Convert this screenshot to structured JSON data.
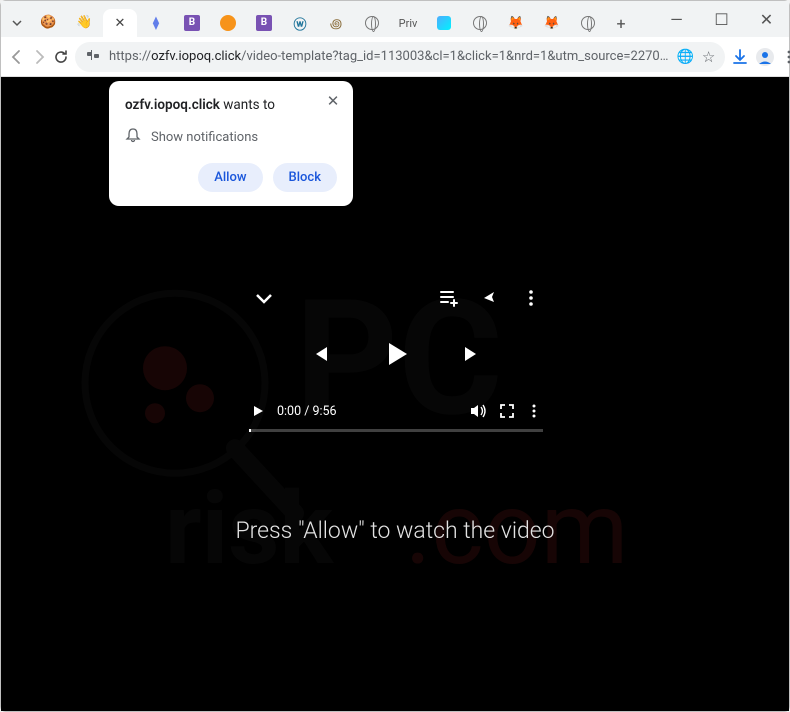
{
  "window": {
    "tabs": [
      {
        "icon": "chevron-down",
        "label": ""
      },
      {
        "icon": "curl",
        "label": ""
      },
      {
        "icon": "wave",
        "label": ""
      },
      {
        "icon": "x",
        "label": "",
        "active": true
      },
      {
        "icon": "eth",
        "label": ""
      },
      {
        "icon": "b",
        "label": "B"
      },
      {
        "icon": "btc",
        "label": ""
      },
      {
        "icon": "b",
        "label": "B"
      },
      {
        "icon": "wp",
        "label": ""
      },
      {
        "icon": "spiral",
        "label": ""
      },
      {
        "icon": "globe",
        "label": ""
      },
      {
        "icon": "priv",
        "label": "Priv"
      },
      {
        "icon": "blue",
        "label": ""
      },
      {
        "icon": "globe",
        "label": ""
      },
      {
        "icon": "fox",
        "label": ""
      },
      {
        "icon": "fox",
        "label": ""
      },
      {
        "icon": "globe",
        "label": ""
      }
    ],
    "newtab": "+",
    "controls": {
      "minimize": "—",
      "maximize": "☐",
      "close": "✕"
    }
  },
  "addressbar": {
    "scheme": "https://",
    "host": "ozfv.iopoq.click",
    "path": "/video-template?tag_id=113003&cl=1&click=1&nrd=1&utm_source=2270…"
  },
  "permission": {
    "domain": "ozfv.iopoq.click",
    "wants_to": " wants to",
    "show_notifications": "Show notifications",
    "allow": "Allow",
    "block": "Block"
  },
  "player": {
    "current": "0:00",
    "sep": " / ",
    "duration": "9:56"
  },
  "message": "Press \"Allow\" to watch the video",
  "watermark": {
    "brand_line1": "PC",
    "brand_line2": "risk.com"
  }
}
